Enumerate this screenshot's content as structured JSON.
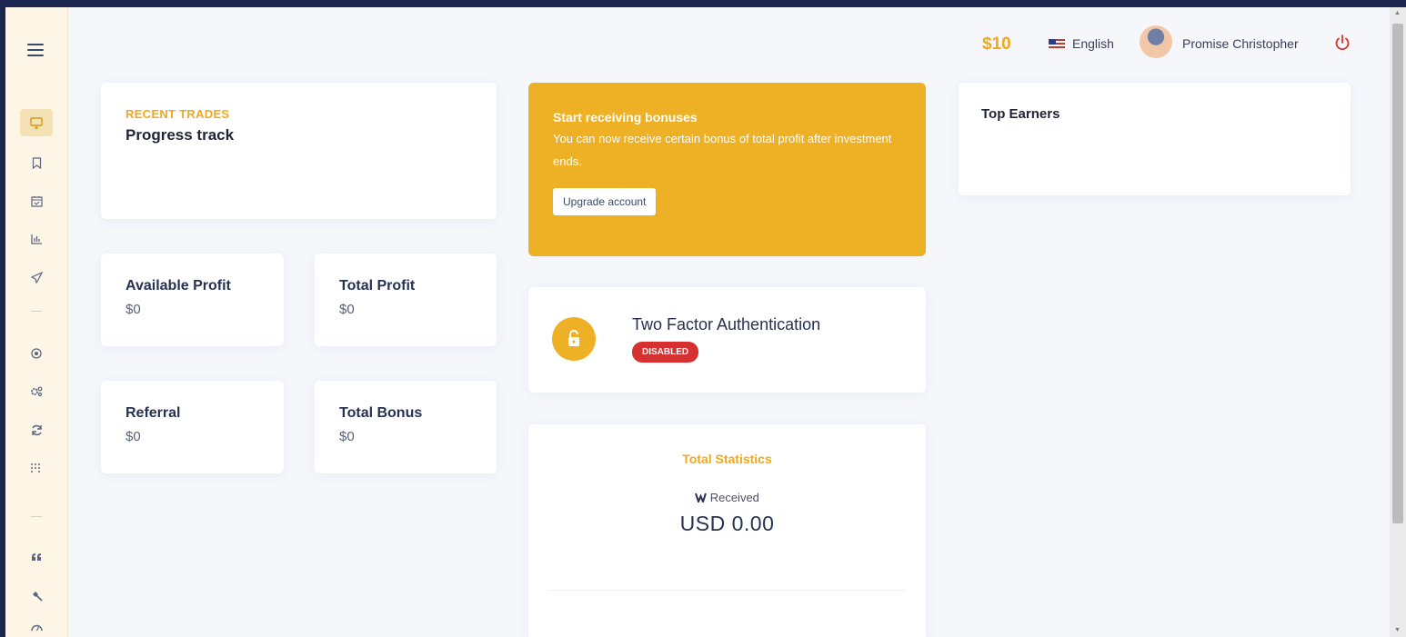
{
  "topbar": {
    "balance": "$10",
    "language": "English",
    "user_name": "Promise Christopher"
  },
  "sidebar": {
    "items": [
      {
        "icon": "monitor-icon",
        "active": true
      },
      {
        "icon": "bookmark-icon"
      },
      {
        "icon": "calendar-icon"
      },
      {
        "icon": "bar-chart-icon"
      },
      {
        "icon": "send-icon"
      },
      {
        "icon": "target-icon"
      },
      {
        "icon": "gears-icon"
      },
      {
        "icon": "refresh-icon"
      },
      {
        "icon": "grid-dots-icon"
      },
      {
        "icon": "quote-icon"
      },
      {
        "icon": "hammer-icon"
      },
      {
        "icon": "gauge-icon"
      }
    ]
  },
  "recent_trades": {
    "eyebrow": "RECENT TRADES",
    "title": "Progress track"
  },
  "stats": {
    "available_profit": {
      "label": "Available Profit",
      "value": "$0"
    },
    "total_profit": {
      "label": "Total Profit",
      "value": "$0"
    },
    "referral": {
      "label": "Referral",
      "value": "$0"
    },
    "total_bonus": {
      "label": "Total Bonus",
      "value": "$0"
    }
  },
  "bonus": {
    "title": "Start receiving bonuses",
    "text": "You can now receive certain bonus of total profit after investment ends.",
    "button": "Upgrade account"
  },
  "two_factor": {
    "title": "Two Factor Authentication",
    "status": "DISABLED"
  },
  "total_statistics": {
    "title": "Total Statistics",
    "received_label": "Received",
    "received_value": "USD 0.00"
  },
  "top_earners": {
    "title": "Top Earners"
  },
  "colors": {
    "accent": "#eeb024",
    "danger": "#d63030",
    "sidebar_bg": "#fdf6e6"
  }
}
